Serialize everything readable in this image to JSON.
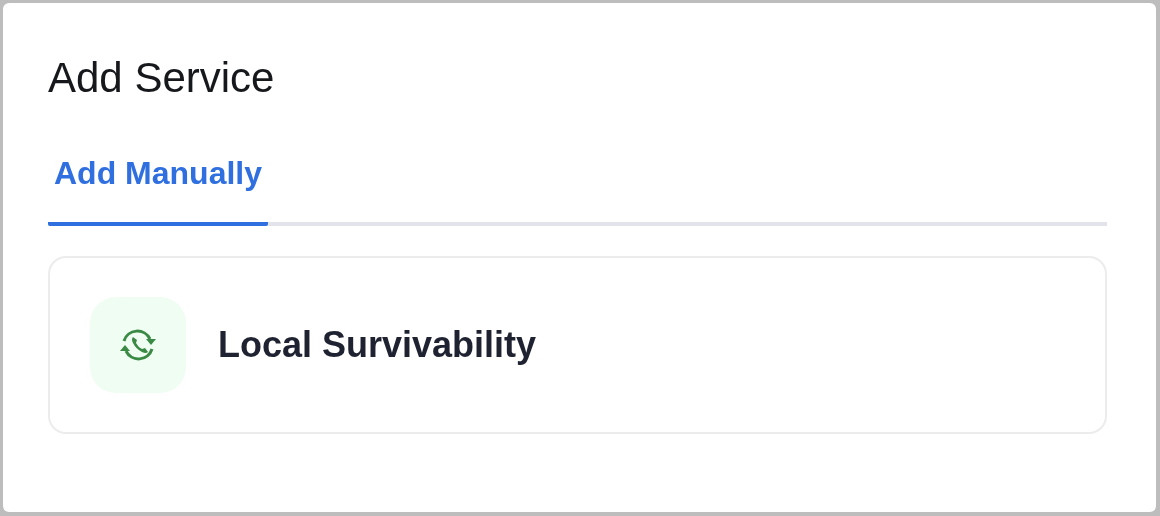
{
  "dialog": {
    "title": "Add Service"
  },
  "tabs": [
    {
      "label": "Add Manually",
      "selected": true
    }
  ],
  "services": [
    {
      "name": "Local Survivability"
    }
  ]
}
